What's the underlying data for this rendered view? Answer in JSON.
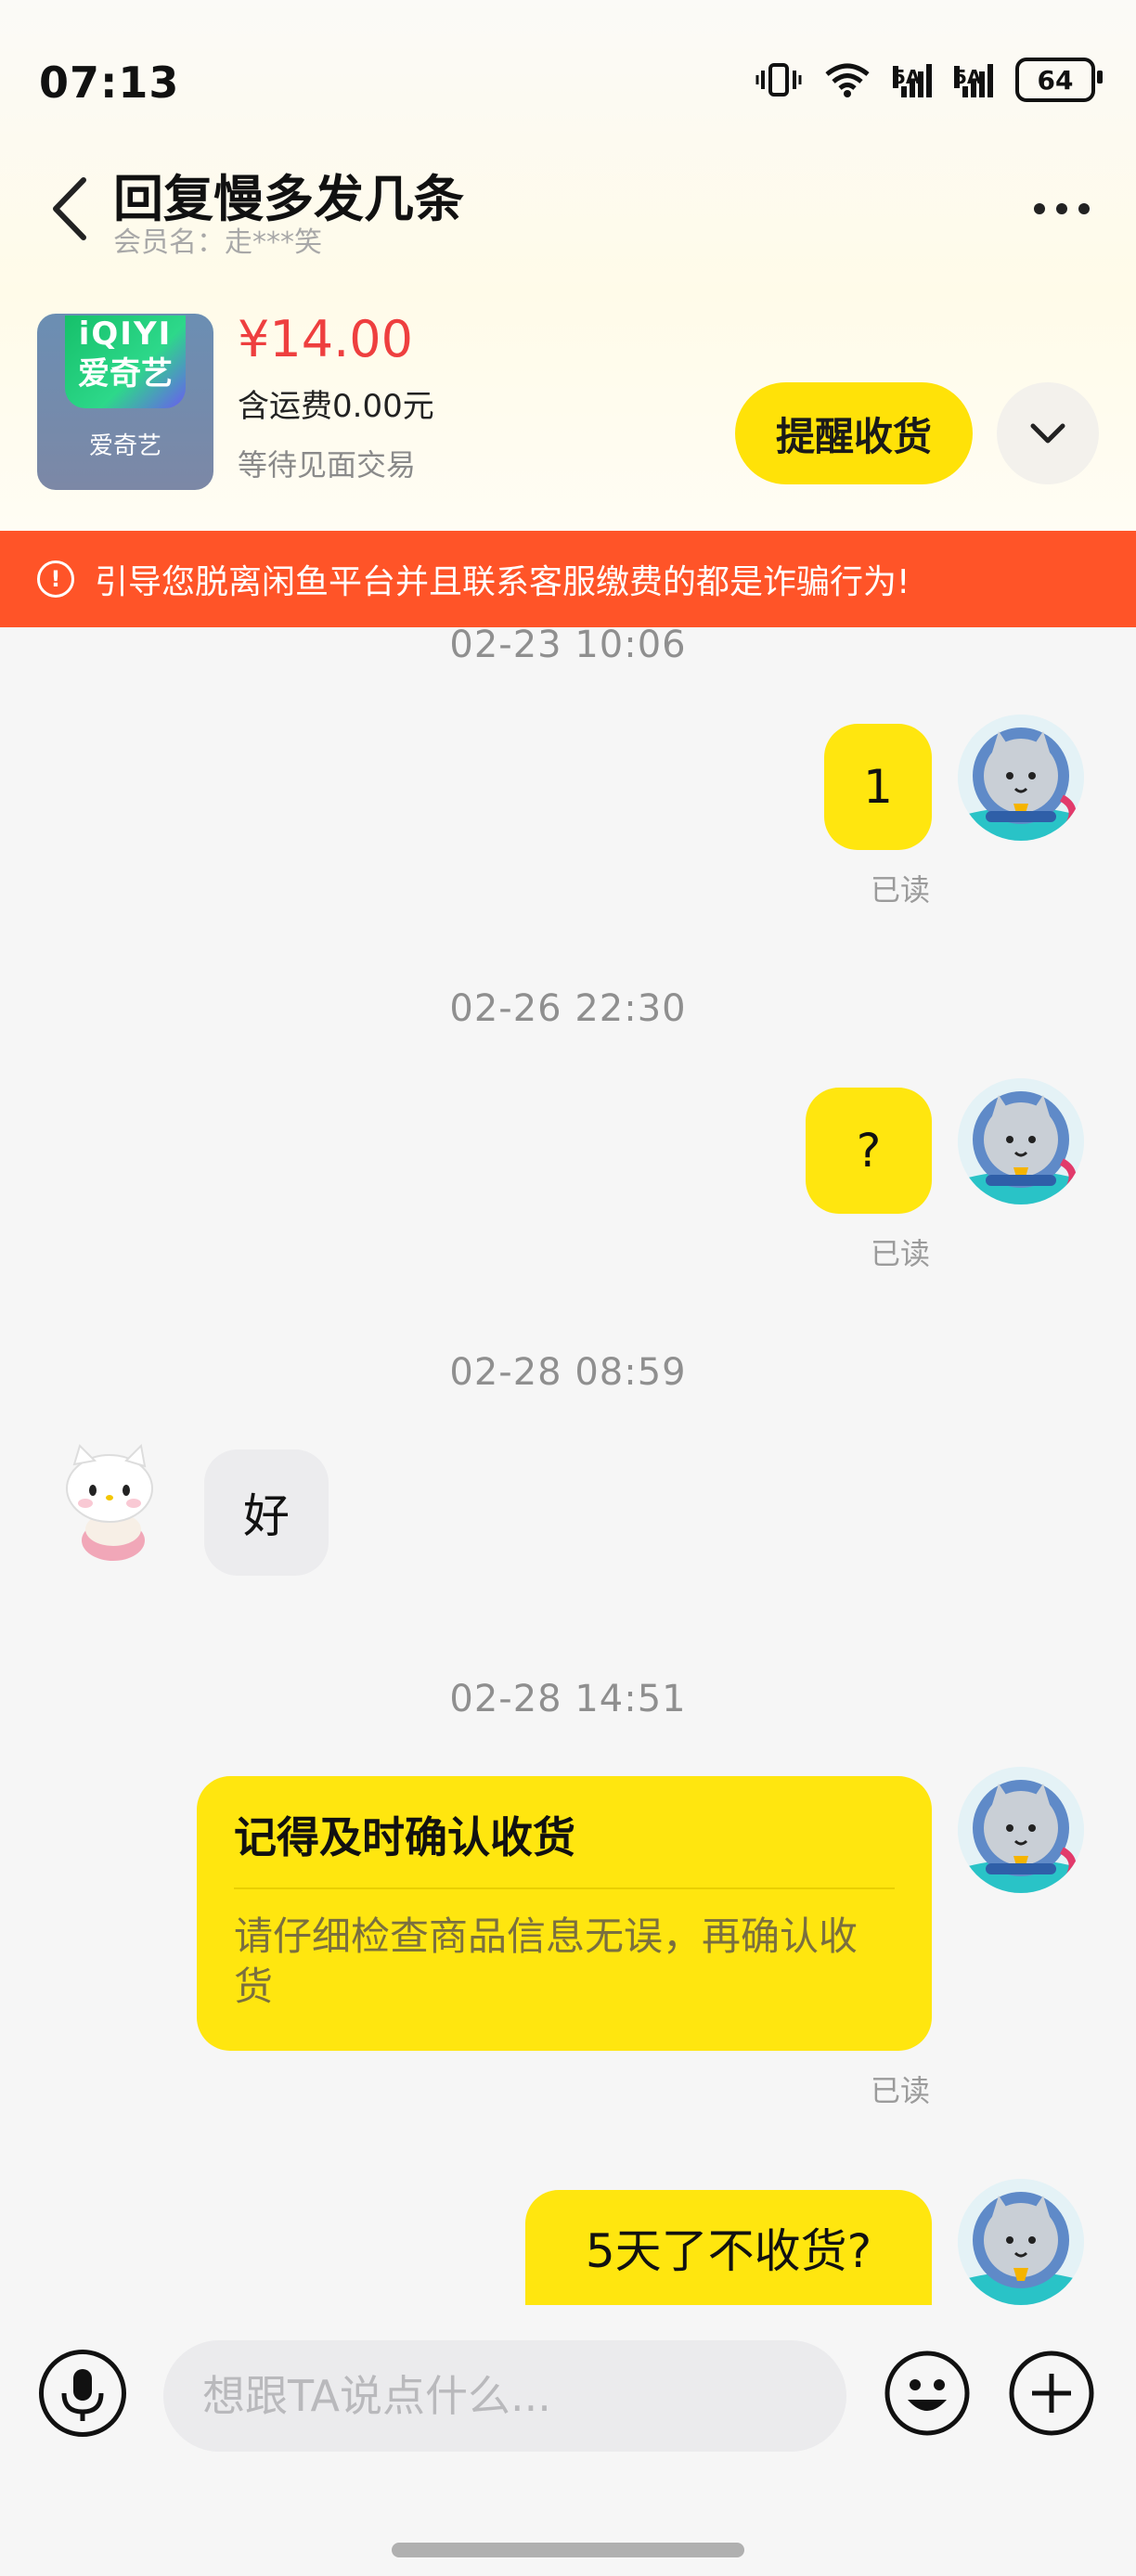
{
  "status_bar": {
    "time": "07:13",
    "battery": "64",
    "signal_1_label": "5A",
    "signal_2_label": "5A"
  },
  "header": {
    "title": "回复慢多发几条",
    "member": "会员名：走***笑"
  },
  "product": {
    "thumb_logo_line1": "iQIYI",
    "thumb_logo_line2": "爱奇艺",
    "thumb_label": "爱奇艺",
    "price": "¥14.00",
    "shipping": "含运费0.00元",
    "status": "等待见面交易",
    "remind_button": "提醒收货"
  },
  "warning": {
    "icon": "!",
    "text": "引导您脱离闲鱼平台并且联系客服缴费的都是诈骗行为!"
  },
  "messages": [
    {
      "timestamp": "02-23 10:06",
      "text": "1",
      "status": "已读"
    },
    {
      "timestamp": "02-26 22:30",
      "text": "?",
      "status": "已读"
    },
    {
      "timestamp": "02-28 08:59",
      "text": "好"
    },
    {
      "timestamp": "02-28 14:51",
      "card_title": "记得及时确认收货",
      "card_body": "请仔细检查商品信息无误，再确认收货",
      "status": "已读"
    },
    {
      "text": "5天了不收货?"
    }
  ],
  "input": {
    "placeholder": "想跟TA说点什么..."
  },
  "colors": {
    "accent_yellow": "#ffe60f",
    "price_red": "#ee3f3f",
    "warning_orange": "#ff5428"
  },
  "icons": [
    "back-arrow-icon",
    "more-dots-icon",
    "chevron-down-icon",
    "microphone-icon",
    "emoji-icon",
    "plus-icon",
    "wifi-icon",
    "vibrate-icon"
  ]
}
